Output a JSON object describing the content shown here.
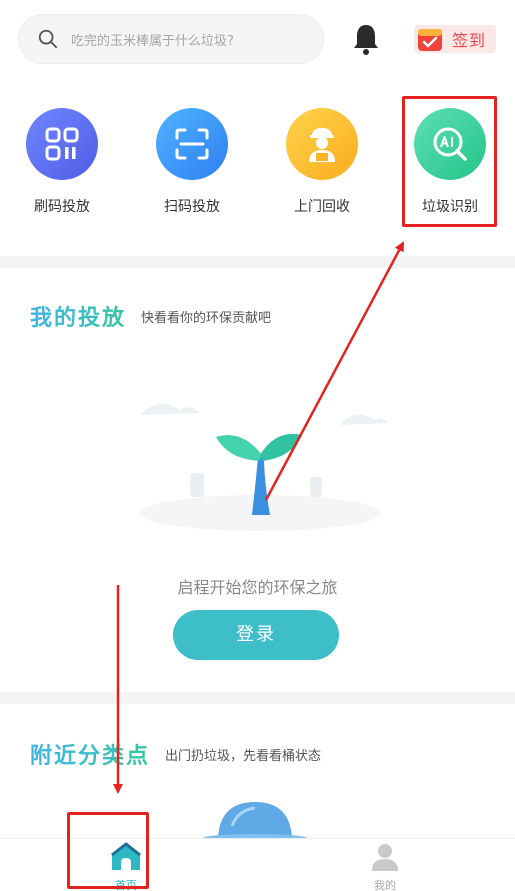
{
  "search": {
    "placeholder": "吃完的玉米棒属于什么垃圾?"
  },
  "header": {
    "checkin_label": "签到"
  },
  "actions": [
    {
      "label": "刷码投放",
      "icon": "qr-code-icon"
    },
    {
      "label": "扫码投放",
      "icon": "scan-icon"
    },
    {
      "label": "上门回收",
      "icon": "courier-icon"
    },
    {
      "label": "垃圾识别",
      "icon": "ai-search-icon"
    }
  ],
  "my_delivery": {
    "title": "我的投放",
    "subtitle": "快看看你的环保贡献吧",
    "tagline": "启程开始您的环保之旅",
    "login_label": "登录"
  },
  "nearby": {
    "title": "附近分类点",
    "subtitle": "出门扔垃圾，先看看桶状态"
  },
  "nav": {
    "home_label": "首页",
    "me_label": "我的"
  },
  "colors": {
    "accent": "#3ebec8",
    "annotation": "#e3231f",
    "title_gradient_start": "#3fb5e8",
    "title_gradient_end": "#35c6a0"
  }
}
